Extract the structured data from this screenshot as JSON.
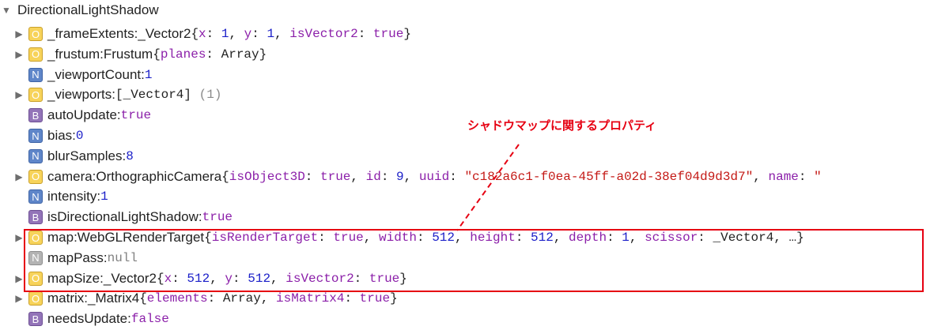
{
  "root": {
    "label": "DirectionalLightShadow"
  },
  "rows": [
    {
      "badge": "O",
      "key": "_frameExtents",
      "type": "_Vector2",
      "parts": [
        [
          "p",
          "{"
        ],
        [
          "k",
          "x"
        ],
        [
          "p",
          ": "
        ],
        [
          "n",
          "1"
        ],
        [
          "p",
          ", "
        ],
        [
          "k",
          "y"
        ],
        [
          "p",
          ": "
        ],
        [
          "n",
          "1"
        ],
        [
          "p",
          ", "
        ],
        [
          "k",
          "isVector2"
        ],
        [
          "p",
          ": "
        ],
        [
          "b",
          "true"
        ],
        [
          "p",
          "}"
        ]
      ]
    },
    {
      "badge": "O",
      "key": "_frustum",
      "type": "Frustum",
      "parts": [
        [
          "p",
          "{"
        ],
        [
          "k",
          "planes"
        ],
        [
          "p",
          ": Array}"
        ]
      ]
    },
    {
      "badge": "N",
      "key": "_viewportCount",
      "parts": [
        [
          "n",
          "1"
        ]
      ]
    },
    {
      "badge": "O",
      "key": "_viewports",
      "type": "",
      "parts": [
        [
          "p",
          "[_Vector4] "
        ],
        [
          "d",
          "(1)"
        ]
      ]
    },
    {
      "badge": "B",
      "key": "autoUpdate",
      "parts": [
        [
          "b",
          "true"
        ]
      ]
    },
    {
      "badge": "N",
      "key": "bias",
      "parts": [
        [
          "n",
          "0"
        ]
      ]
    },
    {
      "badge": "N",
      "key": "blurSamples",
      "parts": [
        [
          "n",
          "8"
        ]
      ]
    },
    {
      "badge": "O",
      "key": "camera",
      "type": "OrthographicCamera",
      "parts": [
        [
          "p",
          "{"
        ],
        [
          "k",
          "isObject3D"
        ],
        [
          "p",
          ": "
        ],
        [
          "b",
          "true"
        ],
        [
          "p",
          ", "
        ],
        [
          "k",
          "id"
        ],
        [
          "p",
          ": "
        ],
        [
          "n",
          "9"
        ],
        [
          "p",
          ", "
        ],
        [
          "k",
          "uuid"
        ],
        [
          "p",
          ": "
        ],
        [
          "s",
          "\"c182a6c1-f0ea-45ff-a02d-38ef04d9d3d7\""
        ],
        [
          "p",
          ", "
        ],
        [
          "k",
          "name"
        ],
        [
          "p",
          ": "
        ],
        [
          "s",
          "\""
        ]
      ]
    },
    {
      "badge": "N",
      "key": "intensity",
      "parts": [
        [
          "n",
          "1"
        ]
      ]
    },
    {
      "badge": "B",
      "key": "isDirectionalLightShadow",
      "parts": [
        [
          "b",
          "true"
        ]
      ]
    },
    {
      "badge": "O",
      "key": "map",
      "type": "WebGLRenderTarget",
      "parts": [
        [
          "p",
          "{"
        ],
        [
          "k",
          "isRenderTarget"
        ],
        [
          "p",
          ": "
        ],
        [
          "b",
          "true"
        ],
        [
          "p",
          ", "
        ],
        [
          "k",
          "width"
        ],
        [
          "p",
          ": "
        ],
        [
          "n",
          "512"
        ],
        [
          "p",
          ", "
        ],
        [
          "k",
          "height"
        ],
        [
          "p",
          ": "
        ],
        [
          "n",
          "512"
        ],
        [
          "p",
          ", "
        ],
        [
          "k",
          "depth"
        ],
        [
          "p",
          ": "
        ],
        [
          "n",
          "1"
        ],
        [
          "p",
          ", "
        ],
        [
          "k",
          "scissor"
        ],
        [
          "p",
          ": _Vector4, …}"
        ]
      ]
    },
    {
      "badge": "Ngray",
      "key": "mapPass",
      "parts": [
        [
          "u",
          "null"
        ]
      ]
    },
    {
      "badge": "O",
      "key": "mapSize",
      "type": "_Vector2",
      "parts": [
        [
          "p",
          "{"
        ],
        [
          "k",
          "x"
        ],
        [
          "p",
          ": "
        ],
        [
          "n",
          "512"
        ],
        [
          "p",
          ", "
        ],
        [
          "k",
          "y"
        ],
        [
          "p",
          ": "
        ],
        [
          "n",
          "512"
        ],
        [
          "p",
          ", "
        ],
        [
          "k",
          "isVector2"
        ],
        [
          "p",
          ": "
        ],
        [
          "b",
          "true"
        ],
        [
          "p",
          "}"
        ]
      ]
    },
    {
      "badge": "O",
      "key": "matrix",
      "type": "_Matrix4",
      "parts": [
        [
          "p",
          "{"
        ],
        [
          "k",
          "elements"
        ],
        [
          "p",
          ": Array, "
        ],
        [
          "k",
          "isMatrix4"
        ],
        [
          "p",
          ": "
        ],
        [
          "b",
          "true"
        ],
        [
          "p",
          "}"
        ]
      ]
    },
    {
      "badge": "B",
      "key": "needsUpdate",
      "parts": [
        [
          "b",
          "false"
        ]
      ]
    }
  ],
  "badge_letters": {
    "O": "O",
    "N": "N",
    "B": "B",
    "Ngray": "N"
  },
  "annotation": "シャドウマップに関するプロパティ",
  "colors": {
    "highlight": "#e60012",
    "number": "#1c20c9",
    "keyword": "#8b1fa9",
    "string": "#c41a16"
  }
}
